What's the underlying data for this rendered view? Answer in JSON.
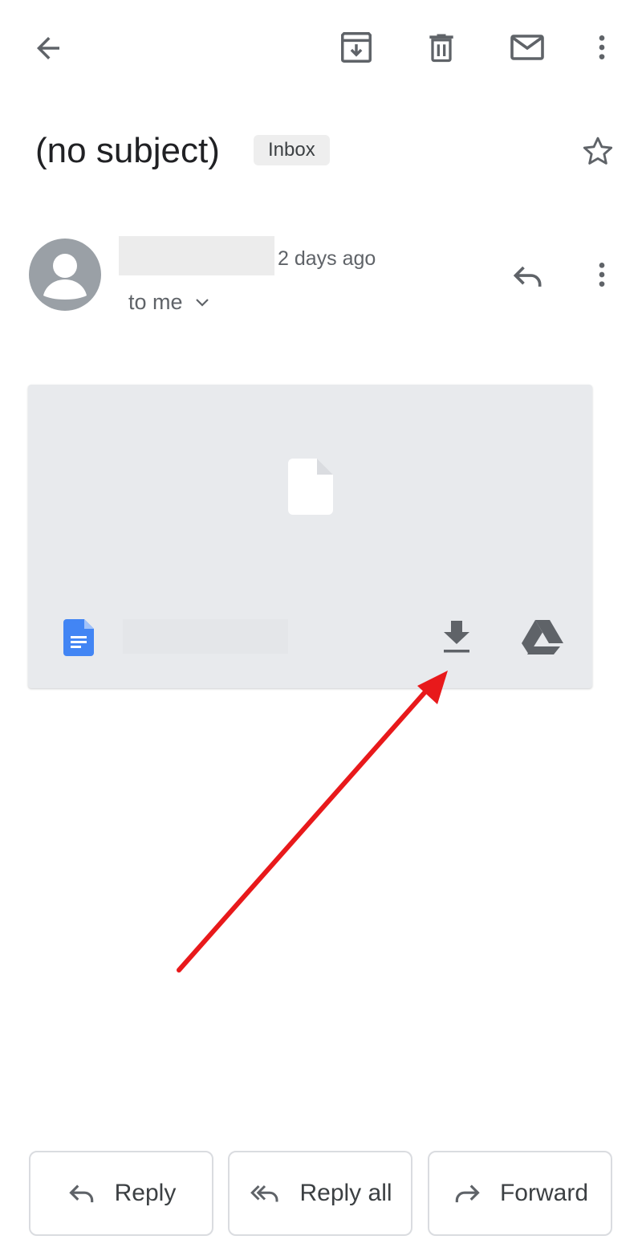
{
  "toolbar": {
    "back_icon": "arrow-back-icon",
    "archive_icon": "archive-icon",
    "delete_icon": "trash-icon",
    "mark_unread_icon": "mail-icon",
    "more_icon": "more-vert-icon"
  },
  "email": {
    "subject": "(no subject)",
    "label": "Inbox",
    "star_icon": "star-outline-icon",
    "sender": {
      "time": "2 days ago",
      "recipient": "to me",
      "avatar_icon": "person-icon"
    }
  },
  "attachment": {
    "preview_icon": "file-icon",
    "type_icon": "google-docs-icon",
    "download_icon": "download-icon",
    "drive_icon": "google-drive-icon"
  },
  "actions": {
    "reply": "Reply",
    "reply_all": "Reply all",
    "forward": "Forward"
  },
  "colors": {
    "icon_gray": "#5f6368",
    "docs_blue": "#4285f4",
    "annotation_red": "#e8191b",
    "card_bg": "#e8eaed"
  }
}
